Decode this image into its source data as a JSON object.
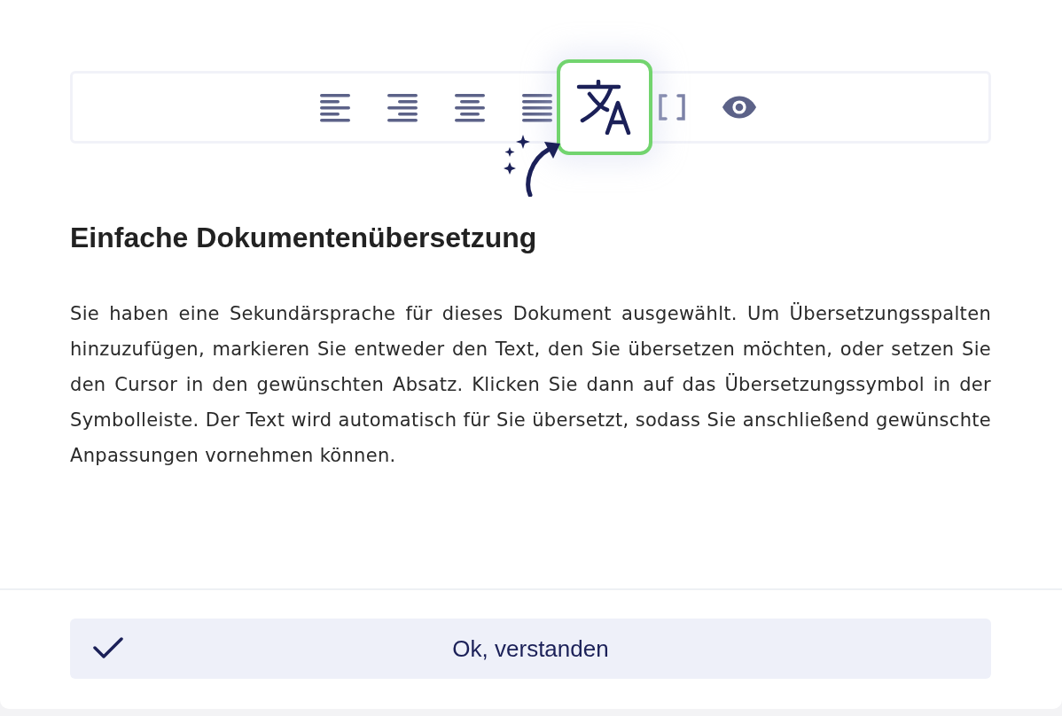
{
  "toolbar": {
    "tools": [
      {
        "kind": "align-left",
        "selected": false
      },
      {
        "kind": "align-right",
        "selected": false
      },
      {
        "kind": "align-center",
        "selected": false
      },
      {
        "kind": "align-justify",
        "selected": false
      },
      {
        "kind": "translate",
        "selected": true
      },
      {
        "kind": "brackets",
        "selected": false
      },
      {
        "kind": "eye",
        "selected": false
      }
    ]
  },
  "title": "Einfache Dokumentenübersetzung",
  "body": "Sie haben eine Sekundärsprache für dieses Dokument ausgewählt. Um Übersetzungsspalten hinzuzufügen, markieren Sie entweder den Text, den Sie übersetzen möchten, oder setzen Sie den Cursor in den gewünschten Absatz. Klicken Sie dann auf das Übersetzungssymbol in der Symbolleiste. Der Text wird automatisch für Sie übersetzt, sodass Sie anschließend gewünschte Anpassungen vornehmen können.",
  "confirm_button": {
    "label": "Ok, verstanden"
  }
}
